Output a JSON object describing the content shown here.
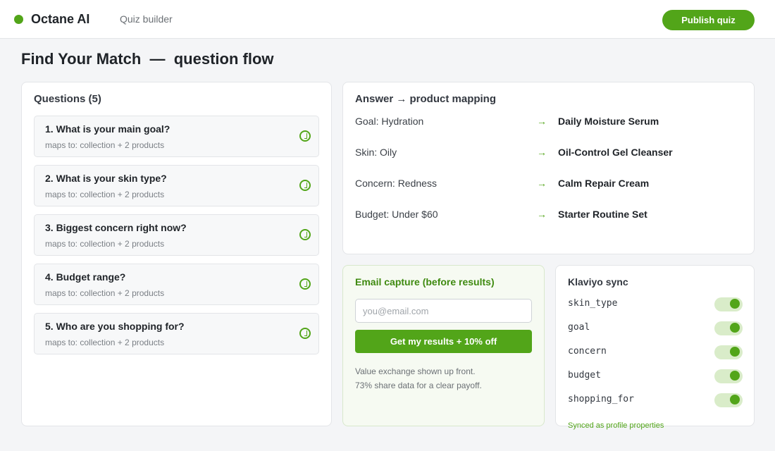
{
  "header": {
    "brand": "Octane AI",
    "nav_link": "Quiz builder",
    "publish_label": "Publish quiz"
  },
  "page": {
    "title": "Find Your Match  —  question flow"
  },
  "questions": {
    "heading": "Questions (5)",
    "items": [
      {
        "title": "1. What is your main goal?",
        "subtitle": "maps to: collection + 2 products"
      },
      {
        "title": "2. What is your skin type?",
        "subtitle": "maps to: collection + 2 products"
      },
      {
        "title": "3. Biggest concern right now?",
        "subtitle": "maps to: collection + 2 products"
      },
      {
        "title": "4. Budget range?",
        "subtitle": "maps to: collection + 2 products"
      },
      {
        "title": "5. Who are you shopping for?",
        "subtitle": "maps to: collection + 2 products"
      }
    ]
  },
  "mapping": {
    "heading": "Answer → product mapping",
    "arrow": "→",
    "rows": [
      {
        "answer": "Goal: Hydration",
        "product": "Daily Moisture Serum"
      },
      {
        "answer": "Skin: Oily",
        "product": "Oil-Control Gel Cleanser"
      },
      {
        "answer": "Concern: Redness",
        "product": "Calm Repair Cream"
      },
      {
        "answer": "Budget: Under $60",
        "product": "Starter Routine Set"
      }
    ]
  },
  "email_capture": {
    "heading": "Email capture (before results)",
    "placeholder": "you@email.com",
    "button_label": "Get my results + 10% off",
    "note_line1": "Value exchange shown up front.",
    "note_line2": "73% share data for a clear payoff."
  },
  "klaviyo": {
    "heading": "Klaviyo sync",
    "properties": [
      {
        "name": "skin_type",
        "enabled": true
      },
      {
        "name": "goal",
        "enabled": true
      },
      {
        "name": "concern",
        "enabled": true
      },
      {
        "name": "budget",
        "enabled": true
      },
      {
        "name": "shopping_for",
        "enabled": true
      }
    ],
    "footer": "Synced as profile properties"
  },
  "colors": {
    "accent": "#52a519",
    "background": "#f4f5f7",
    "email_card_bg": "#f6faf2"
  },
  "icons": {
    "brand": "brand-dot-icon",
    "question_status": "check-circle-icon",
    "mapping_arrow": "arrow-right-icon",
    "toggle": "toggle-on-icon"
  }
}
